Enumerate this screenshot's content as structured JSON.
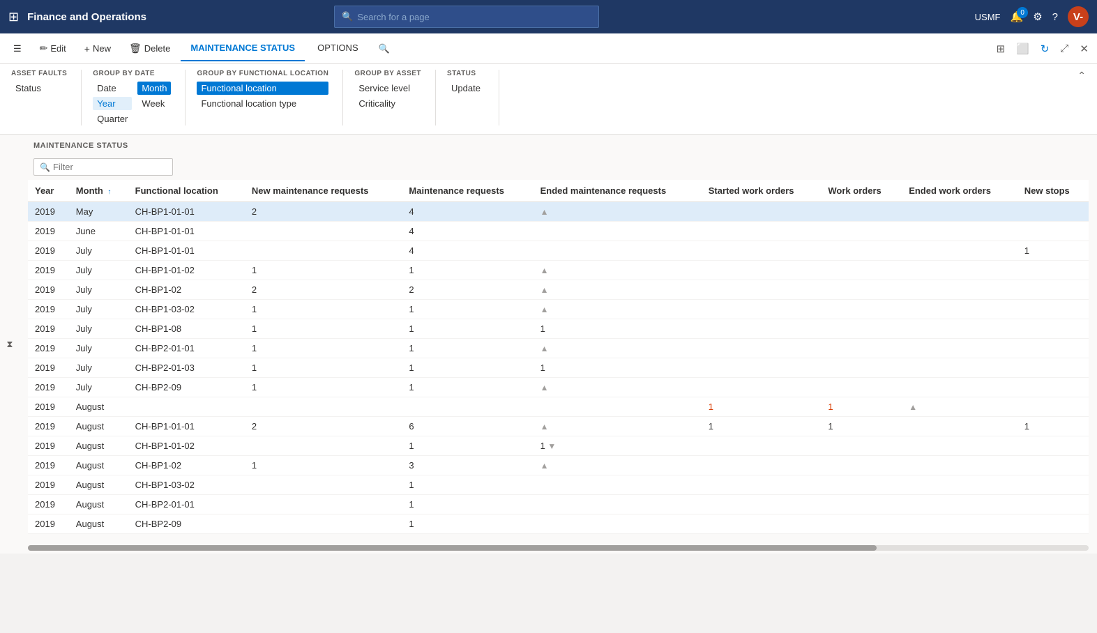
{
  "topNav": {
    "appName": "Finance and Operations",
    "searchPlaceholder": "Search for a page",
    "userInitials": "V-",
    "userName": "USMF",
    "notifCount": "0"
  },
  "commandBar": {
    "editLabel": "Edit",
    "newLabel": "New",
    "deleteLabel": "Delete",
    "tabs": [
      {
        "id": "maintenance-status",
        "label": "MAINTENANCE STATUS",
        "active": true
      },
      {
        "id": "options",
        "label": "OPTIONS",
        "active": false
      }
    ]
  },
  "ribbon": {
    "groups": [
      {
        "id": "asset-faults",
        "title": "ASSET FAULTS",
        "items": [
          {
            "id": "status",
            "label": "Status",
            "selected": false
          }
        ]
      },
      {
        "id": "group-by-date",
        "title": "GROUP BY DATE",
        "items": [
          {
            "id": "date",
            "label": "Date",
            "selected": false
          },
          {
            "id": "month",
            "label": "Month",
            "selected": true
          },
          {
            "id": "year",
            "label": "Year",
            "selected": false
          },
          {
            "id": "week",
            "label": "Week",
            "selected": false
          },
          {
            "id": "quarter",
            "label": "Quarter",
            "selected": false
          }
        ]
      },
      {
        "id": "group-by-functional-location",
        "title": "GROUP BY FUNCTIONAL LOCATION",
        "items": [
          {
            "id": "functional-location",
            "label": "Functional location",
            "selected": true
          },
          {
            "id": "functional-location-type",
            "label": "Functional location type",
            "selected": false
          }
        ]
      },
      {
        "id": "group-by-asset",
        "title": "GROUP BY ASSET",
        "items": [
          {
            "id": "service-level",
            "label": "Service level",
            "selected": false
          },
          {
            "id": "criticality",
            "label": "Criticality",
            "selected": false
          }
        ]
      },
      {
        "id": "status",
        "title": "STATUS",
        "items": [
          {
            "id": "update",
            "label": "Update",
            "selected": false
          }
        ]
      }
    ]
  },
  "mainSection": {
    "title": "MAINTENANCE STATUS",
    "filterPlaceholder": "Filter",
    "columns": [
      {
        "id": "year",
        "label": "Year"
      },
      {
        "id": "month",
        "label": "Month",
        "sortAsc": true
      },
      {
        "id": "functional-location",
        "label": "Functional location"
      },
      {
        "id": "new-maintenance-requests",
        "label": "New maintenance requests"
      },
      {
        "id": "maintenance-requests",
        "label": "Maintenance requests"
      },
      {
        "id": "ended-maintenance-requests",
        "label": "Ended maintenance requests"
      },
      {
        "id": "started-work-orders",
        "label": "Started work orders"
      },
      {
        "id": "work-orders",
        "label": "Work orders"
      },
      {
        "id": "ended-work-orders",
        "label": "Ended work orders"
      },
      {
        "id": "new-stops",
        "label": "New stops"
      }
    ],
    "rows": [
      {
        "year": "2019",
        "month": "May",
        "functionalLocation": "CH-BP1-01-01",
        "newMR": "2",
        "mr": "4",
        "endedMR": "up",
        "startedWO": "",
        "wo": "",
        "endedWO": "",
        "newStops": "",
        "selected": true
      },
      {
        "year": "2019",
        "month": "June",
        "functionalLocation": "CH-BP1-01-01",
        "newMR": "",
        "mr": "4",
        "endedMR": "",
        "startedWO": "",
        "wo": "",
        "endedWO": "",
        "newStops": ""
      },
      {
        "year": "2019",
        "month": "July",
        "functionalLocation": "CH-BP1-01-01",
        "newMR": "",
        "mr": "4",
        "endedMR": "",
        "startedWO": "",
        "wo": "",
        "endedWO": "",
        "newStops": "1"
      },
      {
        "year": "2019",
        "month": "July",
        "functionalLocation": "CH-BP1-01-02",
        "newMR": "1",
        "mr": "1",
        "endedMR": "up",
        "startedWO": "",
        "wo": "",
        "endedWO": "",
        "newStops": ""
      },
      {
        "year": "2019",
        "month": "July",
        "functionalLocation": "CH-BP1-02",
        "newMR": "2",
        "mr": "2",
        "endedMR": "up",
        "startedWO": "",
        "wo": "",
        "endedWO": "",
        "newStops": ""
      },
      {
        "year": "2019",
        "month": "July",
        "functionalLocation": "CH-BP1-03-02",
        "newMR": "1",
        "mr": "1",
        "endedMR": "up",
        "startedWO": "",
        "wo": "",
        "endedWO": "",
        "newStops": ""
      },
      {
        "year": "2019",
        "month": "July",
        "functionalLocation": "CH-BP1-08",
        "newMR": "1",
        "mr": "1",
        "endedMR": "1",
        "startedWO": "",
        "wo": "",
        "endedWO": "",
        "newStops": ""
      },
      {
        "year": "2019",
        "month": "July",
        "functionalLocation": "CH-BP2-01-01",
        "newMR": "1",
        "mr": "1",
        "endedMR": "up",
        "startedWO": "",
        "wo": "",
        "endedWO": "",
        "newStops": ""
      },
      {
        "year": "2019",
        "month": "July",
        "functionalLocation": "CH-BP2-01-03",
        "newMR": "1",
        "mr": "1",
        "endedMR": "1",
        "startedWO": "",
        "wo": "",
        "endedWO": "",
        "newStops": ""
      },
      {
        "year": "2019",
        "month": "July",
        "functionalLocation": "CH-BP2-09",
        "newMR": "1",
        "mr": "1",
        "endedMR": "up",
        "startedWO": "",
        "wo": "",
        "endedWO": "",
        "newStops": ""
      },
      {
        "year": "2019",
        "month": "August",
        "functionalLocation": "",
        "newMR": "",
        "mr": "",
        "endedMR": "",
        "startedWO": "1",
        "wo": "1",
        "endedWO": "up",
        "newStops": "",
        "orangeWO": true
      },
      {
        "year": "2019",
        "month": "August",
        "functionalLocation": "CH-BP1-01-01",
        "newMR": "2",
        "mr": "6",
        "endedMR": "up",
        "startedWO": "1",
        "wo": "1",
        "endedWO": "",
        "newStops": "1"
      },
      {
        "year": "2019",
        "month": "August",
        "functionalLocation": "CH-BP1-01-02",
        "newMR": "",
        "mr": "1",
        "endedMR": "1down",
        "startedWO": "",
        "wo": "",
        "endedWO": "",
        "newStops": ""
      },
      {
        "year": "2019",
        "month": "August",
        "functionalLocation": "CH-BP1-02",
        "newMR": "1",
        "mr": "3",
        "endedMR": "up",
        "startedWO": "",
        "wo": "",
        "endedWO": "",
        "newStops": ""
      },
      {
        "year": "2019",
        "month": "August",
        "functionalLocation": "CH-BP1-03-02",
        "newMR": "",
        "mr": "1",
        "endedMR": "",
        "startedWO": "",
        "wo": "",
        "endedWO": "",
        "newStops": ""
      },
      {
        "year": "2019",
        "month": "August",
        "functionalLocation": "CH-BP2-01-01",
        "newMR": "",
        "mr": "1",
        "endedMR": "",
        "startedWO": "",
        "wo": "",
        "endedWO": "",
        "newStops": ""
      },
      {
        "year": "2019",
        "month": "August",
        "functionalLocation": "CH-BP2-09",
        "newMR": "",
        "mr": "1",
        "endedMR": "",
        "startedWO": "",
        "wo": "",
        "endedWO": "",
        "newStops": ""
      }
    ]
  }
}
